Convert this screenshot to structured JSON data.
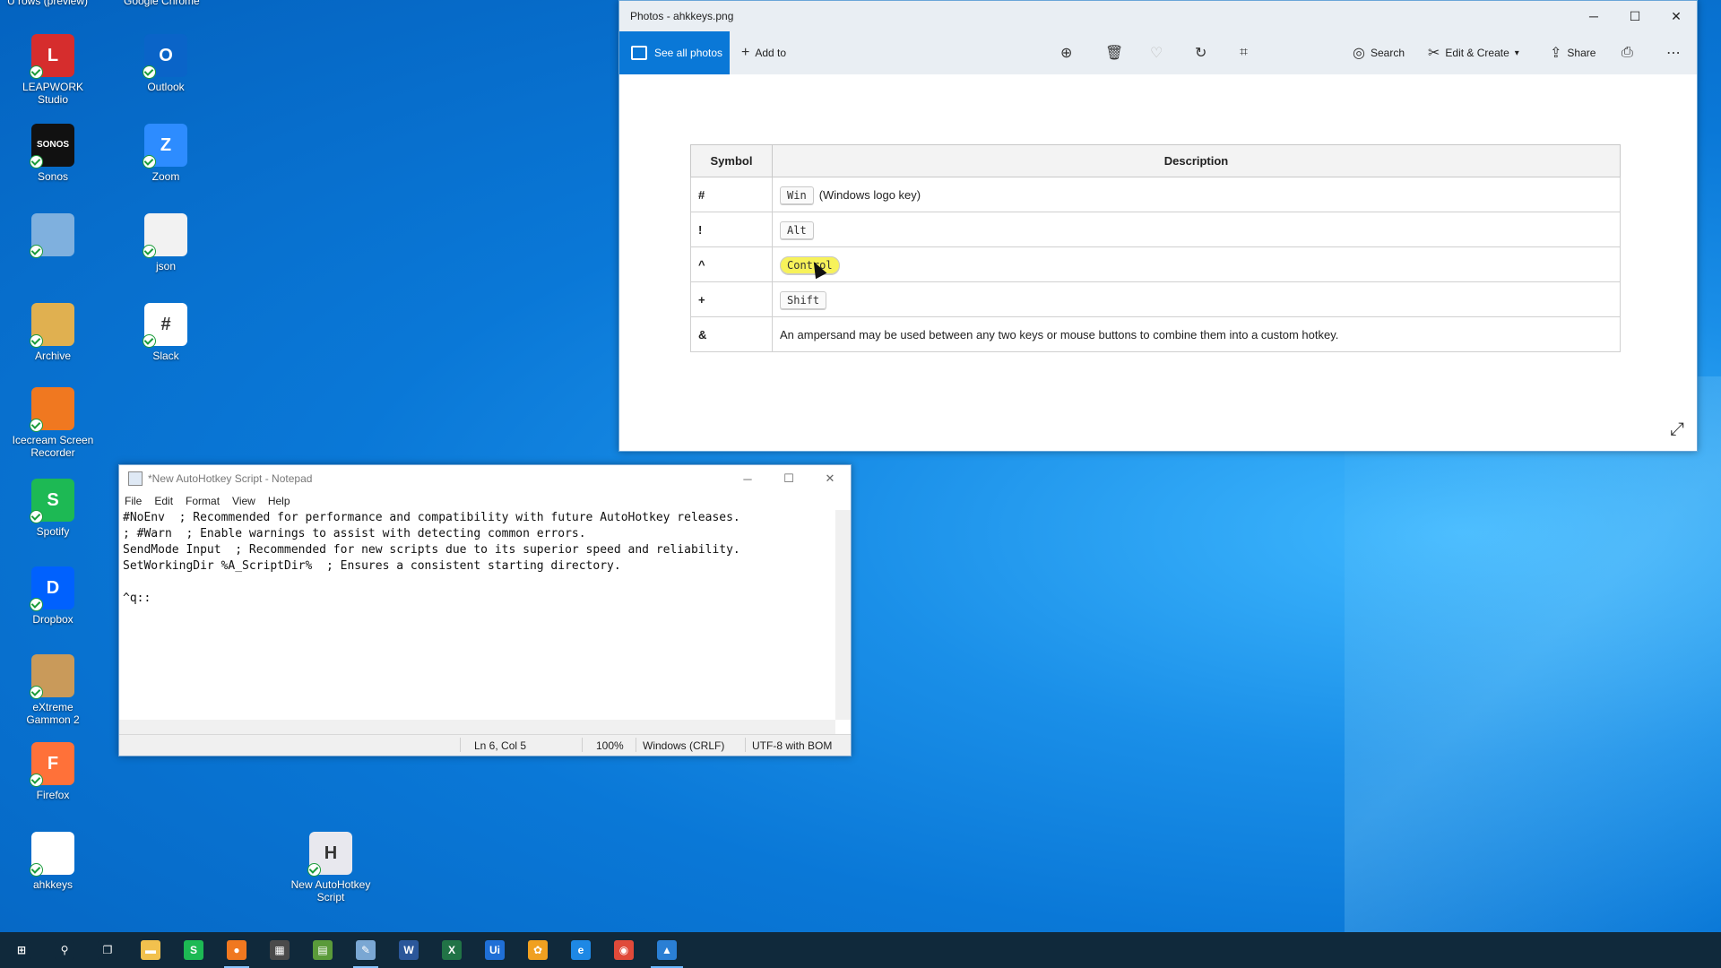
{
  "desktop": {
    "top_partial_labels": [
      "U rows (preview)",
      "Google Chrome"
    ],
    "icons": [
      {
        "label": "LEAPWORK Studio",
        "glyph": "L",
        "color": "#d62d2d"
      },
      {
        "label": "Outlook",
        "glyph": "O",
        "color": "#0a64c8"
      },
      {
        "label": "Sonos",
        "glyph": "SONOS",
        "color": "#111111"
      },
      {
        "label": "Zoom",
        "glyph": "Z",
        "color": "#2d8cff"
      },
      {
        "label": "",
        "glyph": "",
        "color": "#7fb0de"
      },
      {
        "label": "json",
        "glyph": "",
        "color": "#f2f2f2"
      },
      {
        "label": "Archive",
        "glyph": "",
        "color": "#e0b050"
      },
      {
        "label": "Slack",
        "glyph": "#",
        "color": "#ffffff"
      },
      {
        "label": "Icecream Screen Recorder",
        "glyph": "",
        "color": "#f07820"
      },
      {
        "label": "Spotify",
        "glyph": "S",
        "color": "#1db954"
      },
      {
        "label": "Dropbox",
        "glyph": "D",
        "color": "#0061fe"
      },
      {
        "label": "eXtreme Gammon 2",
        "glyph": "",
        "color": "#c99a5a"
      },
      {
        "label": "Firefox",
        "glyph": "F",
        "color": "#ff7139"
      },
      {
        "label": "ahkkeys",
        "glyph": "",
        "color": "#ffffff"
      },
      {
        "label": "New AutoHotkey Script",
        "glyph": "H",
        "color": "#e8e8ee"
      }
    ]
  },
  "photos": {
    "title": "Photos - ahkkeys.png",
    "toolbar": {
      "see_all": "See all photos",
      "add_to": "Add to",
      "search": "Search",
      "edit_create": "Edit & Create",
      "share": "Share"
    },
    "table": {
      "headers": [
        "Symbol",
        "Description"
      ],
      "rows": [
        {
          "symbol": "#",
          "key": "Win",
          "text": "(Windows logo key)"
        },
        {
          "symbol": "!",
          "key": "Alt",
          "text": ""
        },
        {
          "symbol": "^",
          "key": "Control",
          "text": ""
        },
        {
          "symbol": "+",
          "key": "Shift",
          "text": ""
        },
        {
          "symbol": "&",
          "key": "",
          "text": "An ampersand may be used between any two keys or mouse buttons to combine them into a custom hotkey."
        }
      ]
    }
  },
  "notepad": {
    "title": "*New AutoHotkey Script - Notepad",
    "menu": [
      "File",
      "Edit",
      "Format",
      "View",
      "Help"
    ],
    "content": "#NoEnv  ; Recommended for performance and compatibility with future AutoHotkey releases.\n; #Warn  ; Enable warnings to assist with detecting common errors.\nSendMode Input  ; Recommended for new scripts due to its superior speed and reliability.\nSetWorkingDir %A_ScriptDir%  ; Ensures a consistent starting directory.\n\n^q::",
    "status": {
      "position": "Ln 6, Col 5",
      "zoom": "100%",
      "line_ending": "Windows (CRLF)",
      "encoding": "UTF-8 with BOM"
    }
  },
  "taskbar": {
    "items": [
      {
        "name": "start",
        "glyph": "⊞",
        "color": "#10293b"
      },
      {
        "name": "search",
        "glyph": "⚲",
        "color": "#10293b"
      },
      {
        "name": "task-view",
        "glyph": "❐",
        "color": "#10293b"
      },
      {
        "name": "file-explorer",
        "glyph": "▬",
        "color": "#f2c14e"
      },
      {
        "name": "spotify",
        "glyph": "S",
        "color": "#1db954"
      },
      {
        "name": "icecream",
        "glyph": "●",
        "color": "#f07820"
      },
      {
        "name": "calculator",
        "glyph": "▦",
        "color": "#4a4a4a"
      },
      {
        "name": "notepad-green",
        "glyph": "▤",
        "color": "#5a9a3a"
      },
      {
        "name": "notepad",
        "glyph": "✎",
        "color": "#7aa7d3"
      },
      {
        "name": "word",
        "glyph": "W",
        "color": "#2b579a"
      },
      {
        "name": "excel",
        "glyph": "X",
        "color": "#217346"
      },
      {
        "name": "uipath",
        "glyph": "Ui",
        "color": "#1f6fd6"
      },
      {
        "name": "app-orange",
        "glyph": "✿",
        "color": "#f0a020"
      },
      {
        "name": "edge",
        "glyph": "e",
        "color": "#1e88e5"
      },
      {
        "name": "chrome",
        "glyph": "◉",
        "color": "#e04a3a"
      },
      {
        "name": "photos",
        "glyph": "▲",
        "color": "#2a7fd4"
      }
    ]
  }
}
